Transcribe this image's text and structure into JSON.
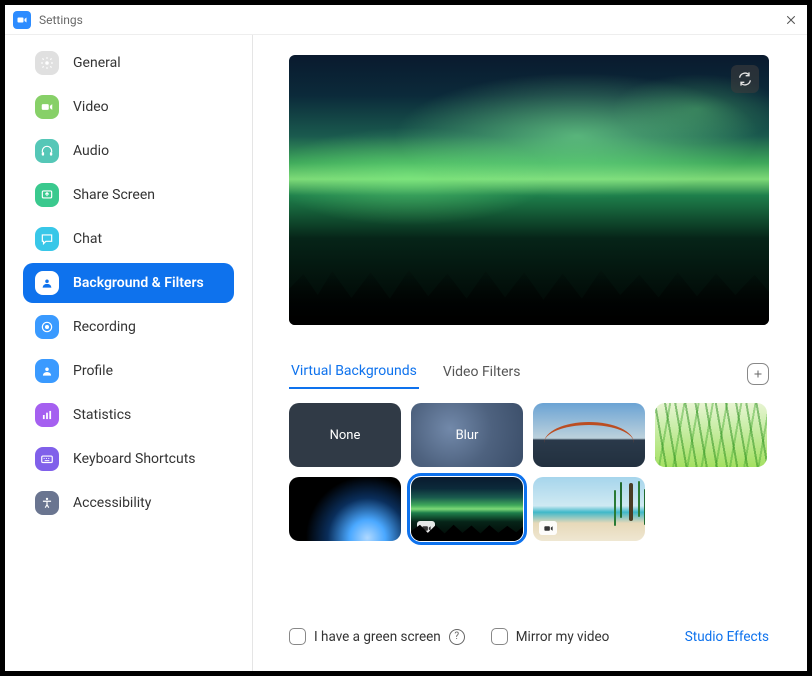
{
  "window": {
    "title": "Settings"
  },
  "sidebar": {
    "items": [
      {
        "label": "General"
      },
      {
        "label": "Video"
      },
      {
        "label": "Audio"
      },
      {
        "label": "Share Screen"
      },
      {
        "label": "Chat"
      },
      {
        "label": "Background & Filters"
      },
      {
        "label": "Recording"
      },
      {
        "label": "Profile"
      },
      {
        "label": "Statistics"
      },
      {
        "label": "Keyboard Shortcuts"
      },
      {
        "label": "Accessibility"
      }
    ]
  },
  "tabs": {
    "virtual_backgrounds": "Virtual Backgrounds",
    "video_filters": "Video Filters"
  },
  "thumbs": {
    "none": "None",
    "blur": "Blur"
  },
  "footer": {
    "green_screen": "I have a green screen",
    "mirror": "Mirror my video",
    "studio": "Studio Effects"
  }
}
